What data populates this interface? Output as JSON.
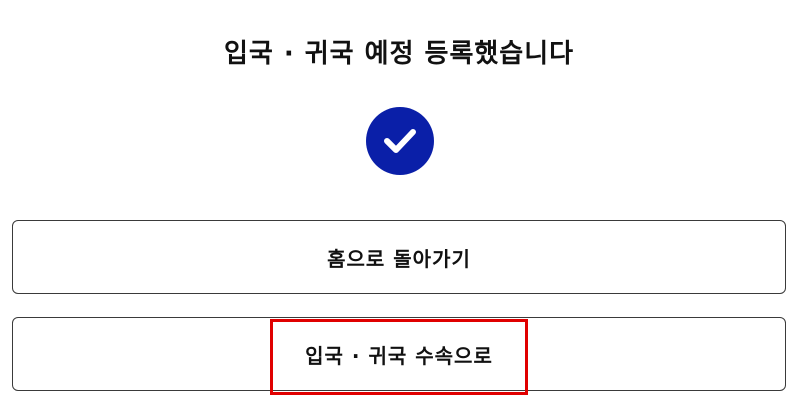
{
  "page": {
    "title": "입국 · 귀국 예정 등록했습니다"
  },
  "status": {
    "icon": "check-circle-icon",
    "color": "#0a1fa8"
  },
  "buttons": {
    "home_label": "홈으로 돌아가기",
    "continue_label": "입국 · 귀국 수속으로"
  },
  "highlight": {
    "color": "#e00000"
  }
}
